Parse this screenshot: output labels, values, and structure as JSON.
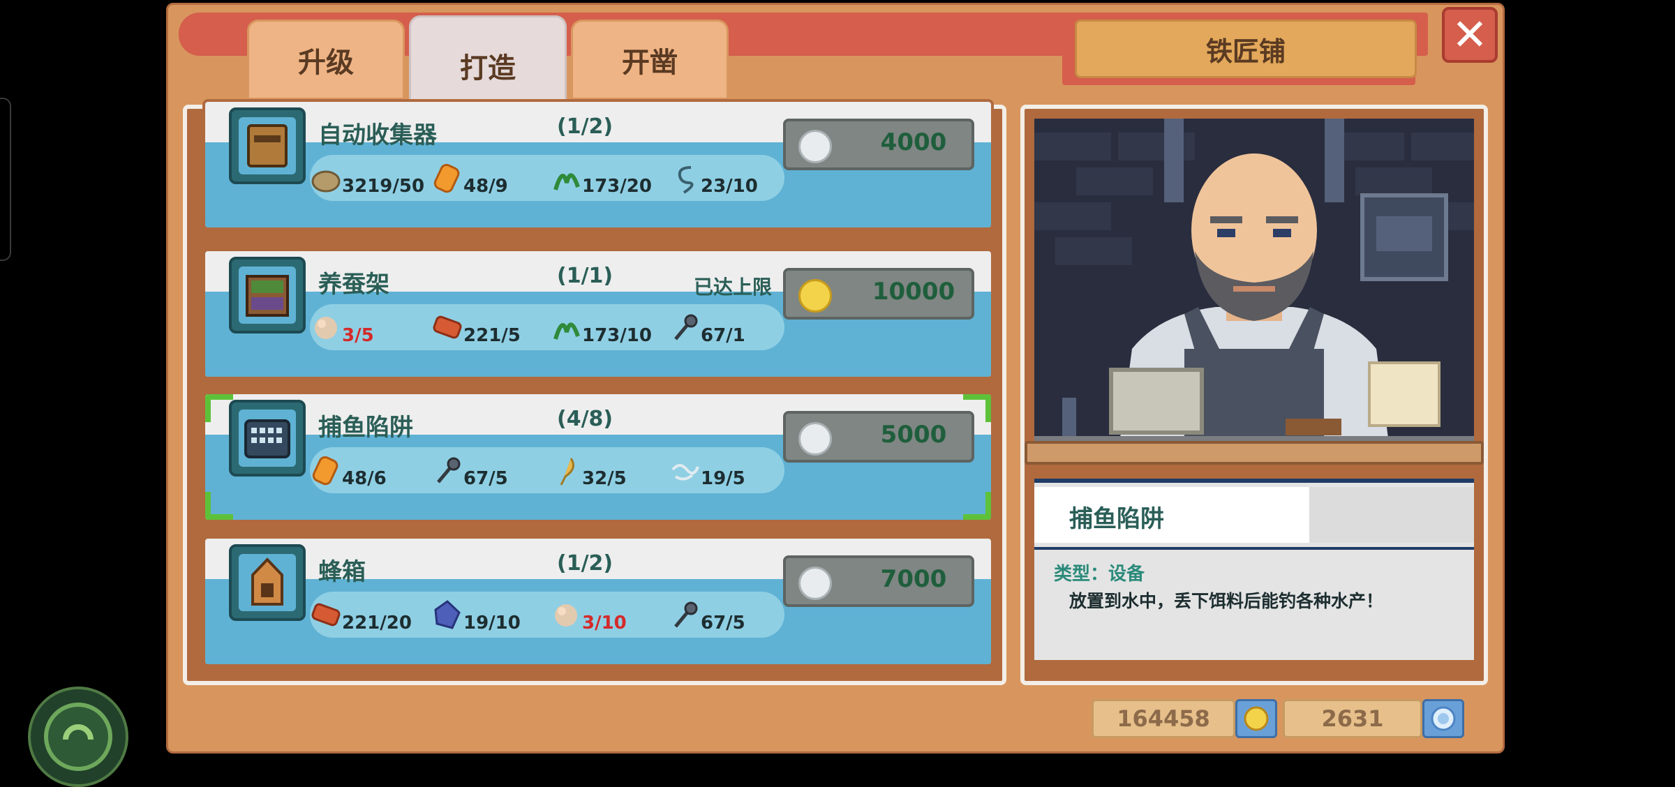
{
  "tabs": [
    {
      "label": "升级",
      "active": false
    },
    {
      "label": "打造",
      "active": true
    },
    {
      "label": "开凿",
      "active": false
    }
  ],
  "shop": {
    "title": "铁匠铺"
  },
  "close": {
    "icon": "close-icon",
    "glyph": "✕"
  },
  "items": [
    {
      "name": "自动收集器",
      "count": "(1/2)",
      "limit": "",
      "price": "4000",
      "price_icon": "silver-coin-icon",
      "selected": false,
      "materials": [
        {
          "icon": "stone-icon",
          "qty": "3219/50",
          "ok": true
        },
        {
          "icon": "copper-ingot-icon",
          "qty": "48/9",
          "ok": true
        },
        {
          "icon": "vine-icon",
          "qty": "173/20",
          "ok": true
        },
        {
          "icon": "wire-icon",
          "qty": "23/10",
          "ok": true
        }
      ]
    },
    {
      "name": "养蚕架",
      "count": "(1/1)",
      "limit": "已达上限",
      "price": "10000",
      "price_icon": "gold-coin-icon",
      "selected": false,
      "materials": [
        {
          "icon": "silk-icon",
          "qty": "3/5",
          "ok": false
        },
        {
          "icon": "brick-icon",
          "qty": "221/5",
          "ok": true
        },
        {
          "icon": "vine-icon",
          "qty": "173/10",
          "ok": true
        },
        {
          "icon": "nail-icon",
          "qty": "67/1",
          "ok": true
        }
      ]
    },
    {
      "name": "捕鱼陷阱",
      "count": "(4/8)",
      "limit": "",
      "price": "5000",
      "price_icon": "silver-coin-icon",
      "selected": true,
      "materials": [
        {
          "icon": "copper-ingot-icon",
          "qty": "48/6",
          "ok": true
        },
        {
          "icon": "nail-icon",
          "qty": "67/5",
          "ok": true
        },
        {
          "icon": "feather-icon",
          "qty": "32/5",
          "ok": true
        },
        {
          "icon": "rope-icon",
          "qty": "19/5",
          "ok": true
        }
      ]
    },
    {
      "name": "蜂箱",
      "count": "(1/2)",
      "limit": "",
      "price": "7000",
      "price_icon": "silver-coin-icon",
      "selected": false,
      "materials": [
        {
          "icon": "brick-icon",
          "qty": "221/20",
          "ok": true
        },
        {
          "icon": "crystal-icon",
          "qty": "19/10",
          "ok": true
        },
        {
          "icon": "silk-icon",
          "qty": "3/10",
          "ok": false
        },
        {
          "icon": "nail-icon",
          "qty": "67/5",
          "ok": true
        }
      ]
    }
  ],
  "detail": {
    "title": "捕鱼陷阱",
    "type": "类型：设备",
    "description": "放置到水中，丢下饵料后能钓各种水产！"
  },
  "currency": [
    {
      "value": "164458",
      "icon": "gold-coin-icon"
    },
    {
      "value": "2631",
      "icon": "diamond-icon"
    }
  ],
  "colors": {
    "panel": "#d8965e",
    "title_bar": "#d55e4c",
    "card_stripe": "#5fb2d4",
    "insufficient": "#d42a2a",
    "selected_corner": "#5ec13a"
  }
}
